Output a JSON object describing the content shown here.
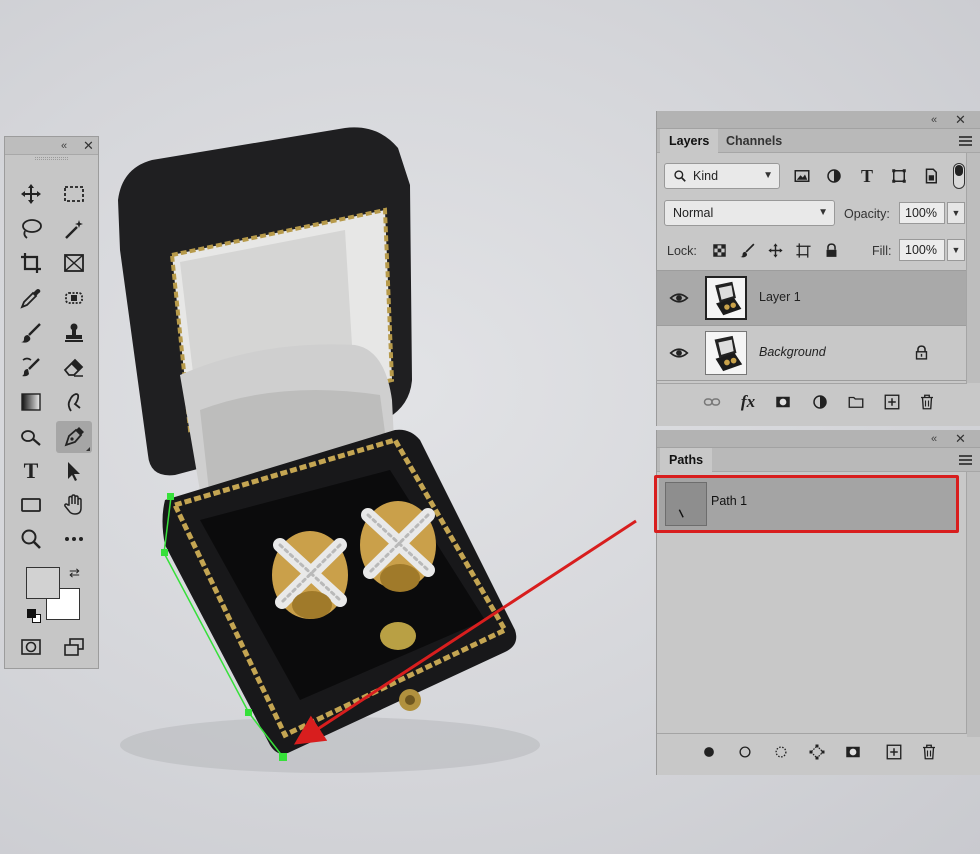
{
  "tools_panel": {
    "collapse_glyph": "«",
    "close_glyph": "✕",
    "tools": [
      {
        "name": "move-tool",
        "icon": "move-icon"
      },
      {
        "name": "marquee-tool",
        "icon": "rectangular-marquee-icon"
      },
      {
        "name": "lasso-tool",
        "icon": "lasso-icon"
      },
      {
        "name": "magic-wand-tool",
        "icon": "magic-wand-icon"
      },
      {
        "name": "crop-tool",
        "icon": "crop-icon"
      },
      {
        "name": "frame-tool",
        "icon": "frame-icon"
      },
      {
        "name": "eyedropper-tool",
        "icon": "eyedropper-icon"
      },
      {
        "name": "spot-healing-tool",
        "icon": "bandage-icon"
      },
      {
        "name": "brush-tool",
        "icon": "brush-icon"
      },
      {
        "name": "clone-stamp-tool",
        "icon": "stamp-icon"
      },
      {
        "name": "history-brush-tool",
        "icon": "history-brush-icon"
      },
      {
        "name": "eraser-tool",
        "icon": "eraser-icon"
      },
      {
        "name": "gradient-tool",
        "icon": "gradient-icon"
      },
      {
        "name": "smudge-tool",
        "icon": "smudge-icon"
      },
      {
        "name": "dodge-tool",
        "icon": "dodge-icon"
      },
      {
        "name": "pen-tool",
        "icon": "pen-icon",
        "active": true
      },
      {
        "name": "type-tool",
        "icon": "type-icon",
        "text": "T"
      },
      {
        "name": "path-selection-tool",
        "icon": "arrow-icon"
      },
      {
        "name": "rectangle-tool",
        "icon": "rectangle-icon"
      },
      {
        "name": "hand-tool",
        "icon": "hand-icon"
      },
      {
        "name": "zoom-tool",
        "icon": "zoom-icon"
      },
      {
        "name": "more-tools",
        "icon": "ellipsis-icon"
      }
    ],
    "foreground_color": "#d2d2d2",
    "background_color": "#ffffff"
  },
  "layers_panel": {
    "collapse_glyph": "«",
    "close_glyph": "✕",
    "tabs": [
      {
        "label": "Layers",
        "active": true
      },
      {
        "label": "Channels",
        "active": false
      }
    ],
    "filter": {
      "label": "Kind"
    },
    "blend_mode": "Normal",
    "opacity_label": "Opacity:",
    "opacity_value": "100%",
    "lock_label": "Lock:",
    "fill_label": "Fill:",
    "fill_value": "100%",
    "layers": [
      {
        "name": "Layer 1",
        "selected": true,
        "visible": true,
        "locked": false
      },
      {
        "name": "Background",
        "selected": false,
        "visible": true,
        "locked": true
      }
    ],
    "footer_fx": "fx"
  },
  "paths_panel": {
    "collapse_glyph": "«",
    "close_glyph": "✕",
    "tab": "Paths",
    "paths": [
      {
        "name": "Path 1",
        "selected": true
      }
    ]
  },
  "annotation": {
    "color": "#d81e1e",
    "path_color": "#36e03a"
  }
}
